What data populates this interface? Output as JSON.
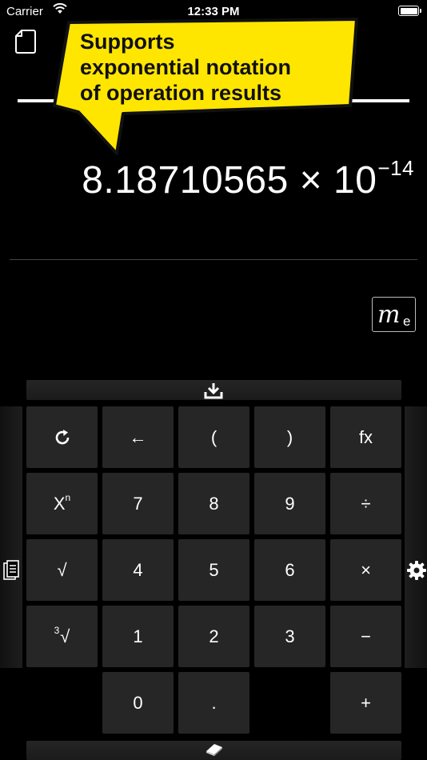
{
  "status_bar": {
    "carrier": "Carrier",
    "time": "12:33 PM"
  },
  "callout": {
    "lines": [
      "Supports",
      "exponential notation",
      "of operation results"
    ],
    "color": "#FFE600"
  },
  "result": {
    "mantissa": "8.18710565",
    "times": "×",
    "base": "10",
    "exponent": "−14"
  },
  "me_button": {
    "symbol": "m",
    "subscript": "e"
  },
  "keypad": {
    "row1": [
      "",
      "",
      "(",
      ")",
      "fx"
    ],
    "row1_icons": [
      "refresh-icon",
      "back-arrow-icon"
    ],
    "back_arrow": "←",
    "row2": {
      "power_base": "X",
      "power_exp": "n",
      "k7": "7",
      "k8": "8",
      "k9": "9",
      "div": "÷"
    },
    "row3": {
      "sqrt": "√",
      "k4": "4",
      "k5": "5",
      "k6": "6",
      "mul": "×"
    },
    "row4": {
      "cbrt_pre": "3",
      "cbrt": "√",
      "k1": "1",
      "k2": "2",
      "k3": "3",
      "sub": "−"
    },
    "row5": {
      "k0": "0",
      "dot": ".",
      "add": "+"
    }
  },
  "colors": {
    "background": "#000000",
    "key": "#262626",
    "callout_fill": "#FFE600"
  }
}
